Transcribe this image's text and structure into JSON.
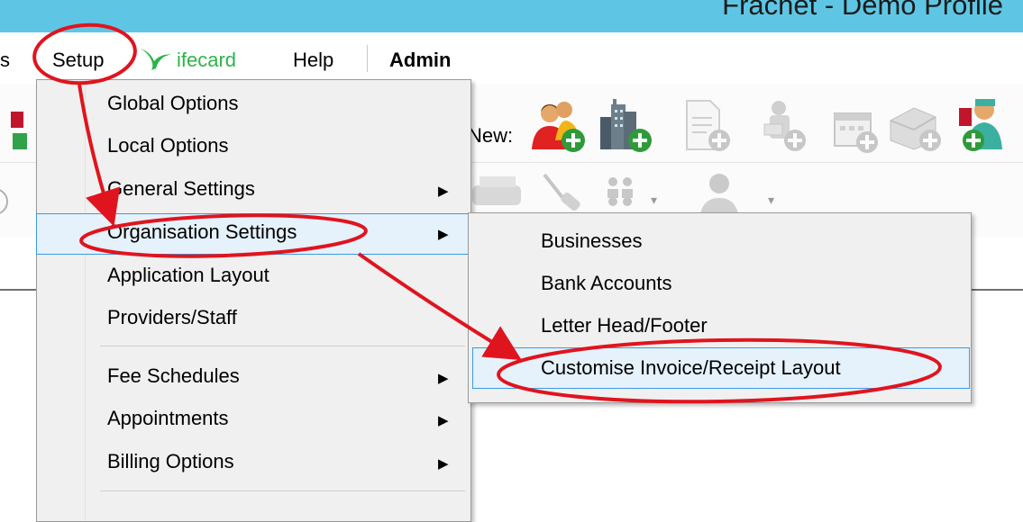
{
  "window": {
    "title": "Frachet - Demo Profile"
  },
  "menubar": {
    "partial_left": "s",
    "items": [
      {
        "label": "Setup",
        "bold": false
      },
      {
        "label": "ifecard",
        "color": "#2db44a",
        "icon": "lifecard-swoosh-icon"
      },
      {
        "label": "Help"
      },
      {
        "label": "Admin",
        "bold": true
      }
    ]
  },
  "toolbar": {
    "new_label": "New:",
    "icons": [
      "new-patient-icon",
      "new-business-icon",
      "new-document-icon",
      "new-payment-icon",
      "new-calendar-icon",
      "new-facility-icon",
      "new-provider-icon"
    ]
  },
  "setup_menu": {
    "items": [
      {
        "label": "Global Options",
        "has_submenu": false
      },
      {
        "label": "Local Options",
        "has_submenu": false
      },
      {
        "label": "General Settings",
        "has_submenu": true
      },
      {
        "label": "Organisation Settings",
        "has_submenu": true,
        "highlighted": true
      },
      {
        "label": "Application Layout",
        "has_submenu": false
      },
      {
        "label": "Providers/Staff",
        "has_submenu": false
      },
      {
        "label": "Fee Schedules",
        "has_submenu": true
      },
      {
        "label": "Appointments",
        "has_submenu": true
      },
      {
        "label": "Billing Options",
        "has_submenu": true
      }
    ]
  },
  "organisation_submenu": {
    "items": [
      {
        "label": "Businesses"
      },
      {
        "label": "Bank Accounts"
      },
      {
        "label": "Letter Head/Footer"
      },
      {
        "label": "Customise Invoice/Receipt Layout",
        "highlighted": true
      }
    ]
  },
  "annotation": {
    "color": "#e0141e"
  }
}
